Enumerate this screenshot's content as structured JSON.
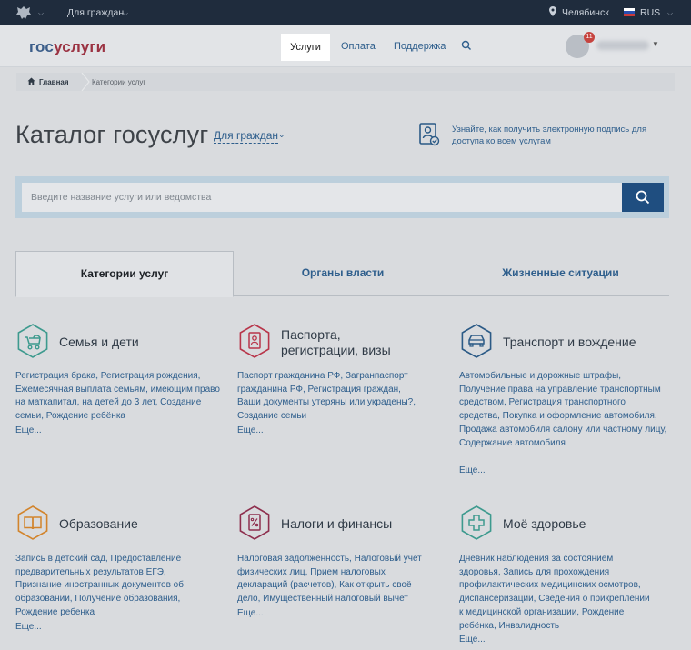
{
  "topbar": {
    "audience": "Для граждан",
    "city": "Челябинск",
    "language": "RUS"
  },
  "header": {
    "logo_gos": "гос",
    "logo_uslugi": "услуги",
    "nav": [
      "Услуги",
      "Оплата",
      "Поддержка"
    ],
    "notifications": "11"
  },
  "breadcrumbs": [
    "Главная",
    "Категории услуг"
  ],
  "main": {
    "title": "Каталог госуслуг",
    "audience_select": "Для граждан",
    "signature_hint": "Узнайте, как получить электронную подпись для доступа ко всем услугам"
  },
  "search": {
    "placeholder": "Введите название услуги или ведомства"
  },
  "tabs": [
    "Категории услуг",
    "Органы власти",
    "Жизненные ситуации"
  ],
  "more_label": "Еще...",
  "categories": [
    {
      "title": "Семья и дети",
      "links": "Регистрация брака, Регистрация рождения, Ежемесячная выплата семьям, имеющим право на маткапитал, на детей до 3 лет, Создание семьи, Рождение ребёнка",
      "icon": "stroller-icon",
      "color": "#3d9a8e"
    },
    {
      "title_line1": "Паспорта,",
      "title_line2": "регистрации, визы",
      "links": "Паспорт гражданина РФ, Загранпаспорт гражданина РФ, Регистрация граждан, Ваши документы утеряны или украдены?, Создание семьи",
      "icon": "passport-icon",
      "color": "#b8354a"
    },
    {
      "title": "Транспорт и вождение",
      "links": "Автомобильные и дорожные штрафы, Получение права на управление транспортным средством, Регистрация транспортного средства, Покупка и оформление автомобиля, Продажа автомобиля салону или частному лицу, Содержание автомобиля",
      "icon": "car-icon",
      "color": "#2b5a86"
    },
    {
      "title": "Образование",
      "links": "Запись в детский сад, Предоставление предварительных результатов ЕГЭ, Признание иностранных документов об образовании, Получение образования, Рождение ребенка",
      "icon": "book-icon",
      "color": "#d2842c"
    },
    {
      "title": "Налоги и финансы",
      "links": "Налоговая задолженность, Налоговый учет физических лиц, Прием налоговых деклараций (расчетов), Как открыть своё дело, Имущественный налоговый вычет",
      "icon": "tax-icon",
      "color": "#8e2f4e"
    },
    {
      "title": "Моё здоровье",
      "links": "Дневник наблюдения за состоянием здоровья, Запись для прохождения профилактических медицинских осмотров, диспансеризации, Сведения о прикреплении к медицинской организации, Рождение ребёнка, Инвалидность",
      "icon": "medical-cross-icon",
      "color": "#3d9a8e"
    }
  ]
}
